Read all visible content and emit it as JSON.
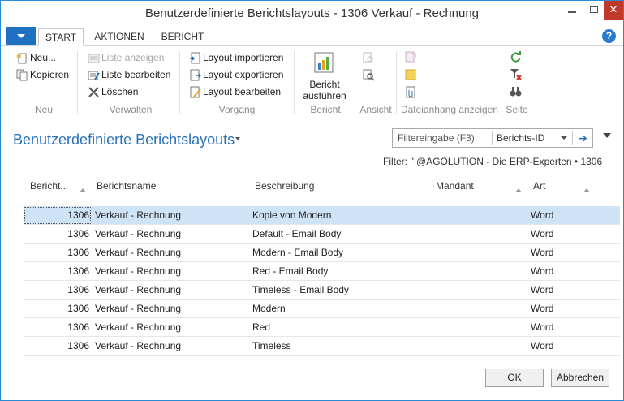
{
  "window": {
    "title": "Benutzerdefinierte Berichtslayouts - 1306 Verkauf - Rechnung",
    "close_glyph": "✕"
  },
  "ribbon_tabs": [
    {
      "label": "START"
    },
    {
      "label": "AKTIONEN"
    },
    {
      "label": "BERICHT"
    }
  ],
  "help_glyph": "?",
  "ribbon": {
    "neu": {
      "new": "Neu...",
      "copy": "Kopieren",
      "group": "Neu"
    },
    "verwalten": {
      "show_list": "Liste anzeigen",
      "edit_list": "Liste bearbeiten",
      "delete": "Löschen",
      "group": "Verwalten"
    },
    "vorgang": {
      "import": "Layout importieren",
      "export": "Layout exportieren",
      "edit": "Layout bearbeiten",
      "group": "Vorgang"
    },
    "bericht": {
      "run_line1": "Bericht",
      "run_line2": "ausführen",
      "group": "Bericht"
    },
    "ansicht": {
      "group": "Ansicht"
    },
    "dateianhang": {
      "group": "Dateianhang anzeigen"
    },
    "seite": {
      "group": "Seite"
    }
  },
  "page": {
    "title": "Benutzerdefinierte Berichtslayouts",
    "filter_placeholder": "Filtereingabe (F3)",
    "filter_field": "Berichts-ID",
    "filter_go": "➔",
    "filter_text": "Filter: ''|@AGOLUTION - Die ERP-Experten • 1306"
  },
  "table": {
    "columns": [
      "Bericht...",
      "Berichtsname",
      "Beschreibung",
      "Mandant",
      "Art"
    ],
    "rows": [
      {
        "id": "1306",
        "name": "Verkauf - Rechnung",
        "description": "Kopie von Modern",
        "company": "",
        "type": "Word"
      },
      {
        "id": "1306",
        "name": "Verkauf - Rechnung",
        "description": "Default - Email Body",
        "company": "",
        "type": "Word"
      },
      {
        "id": "1306",
        "name": "Verkauf - Rechnung",
        "description": "Modern - Email Body",
        "company": "",
        "type": "Word"
      },
      {
        "id": "1306",
        "name": "Verkauf - Rechnung",
        "description": "Red - Email Body",
        "company": "",
        "type": "Word"
      },
      {
        "id": "1306",
        "name": "Verkauf - Rechnung",
        "description": "Timeless - Email Body",
        "company": "",
        "type": "Word"
      },
      {
        "id": "1306",
        "name": "Verkauf - Rechnung",
        "description": "Modern",
        "company": "",
        "type": "Word"
      },
      {
        "id": "1306",
        "name": "Verkauf - Rechnung",
        "description": "Red",
        "company": "",
        "type": "Word"
      },
      {
        "id": "1306",
        "name": "Verkauf - Rechnung",
        "description": "Timeless",
        "company": "",
        "type": "Word"
      }
    ]
  },
  "buttons": {
    "ok": "OK",
    "cancel": "Abbrechen"
  },
  "colors": {
    "accent": "#2a72b8",
    "selected_row": "#cfe3f7",
    "close_button": "#c0392b"
  }
}
